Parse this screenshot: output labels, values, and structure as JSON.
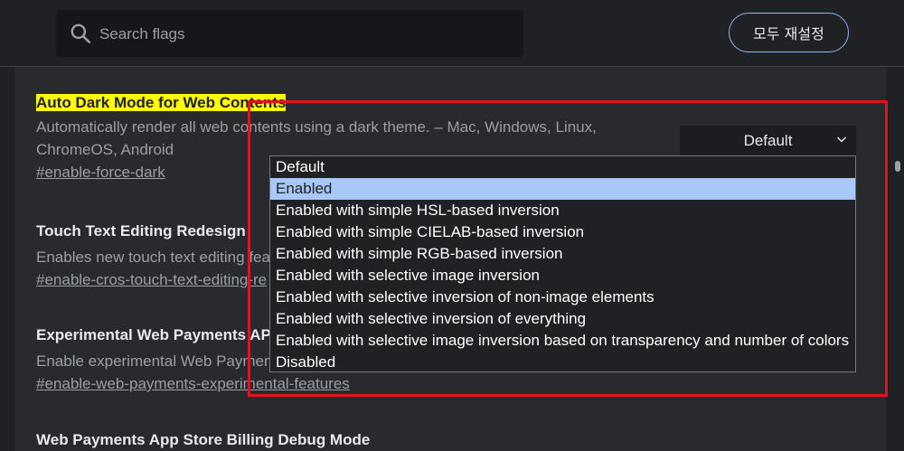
{
  "search": {
    "placeholder": "Search flags"
  },
  "reset_button": {
    "label": "모두 재설정"
  },
  "experiments": [
    {
      "title": "Auto Dark Mode for Web Contents",
      "description": "Automatically render all web contents using a dark theme. – Mac, Windows, Linux, ChromeOS, Android",
      "link": "#enable-force-dark",
      "select_value": "Default"
    },
    {
      "title": "Touch Text Editing Redesign",
      "description": "Enables new touch text editing feat",
      "link": "#enable-cros-touch-text-editing-re"
    },
    {
      "title": "Experimental Web Payments API f",
      "description": "Enable experimental Web Payment",
      "link": "#enable-web-payments-experimental-features"
    },
    {
      "title": "Web Payments App Store Billing Debug Mode"
    }
  ],
  "dropdown_options": [
    "Default",
    "Enabled",
    "Enabled with simple HSL-based inversion",
    "Enabled with simple CIELAB-based inversion",
    "Enabled with simple RGB-based inversion",
    "Enabled with selective image inversion",
    "Enabled with selective inversion of non-image elements",
    "Enabled with selective inversion of everything",
    "Enabled with selective image inversion based on transparency and number of colors",
    "Disabled"
  ],
  "selected_option": "Enabled",
  "colors": {
    "highlight": "#ffff00",
    "annotation_box": "#e8101b",
    "selected_option_bg": "#a8c7fa",
    "accent": "#8ab4f8"
  }
}
